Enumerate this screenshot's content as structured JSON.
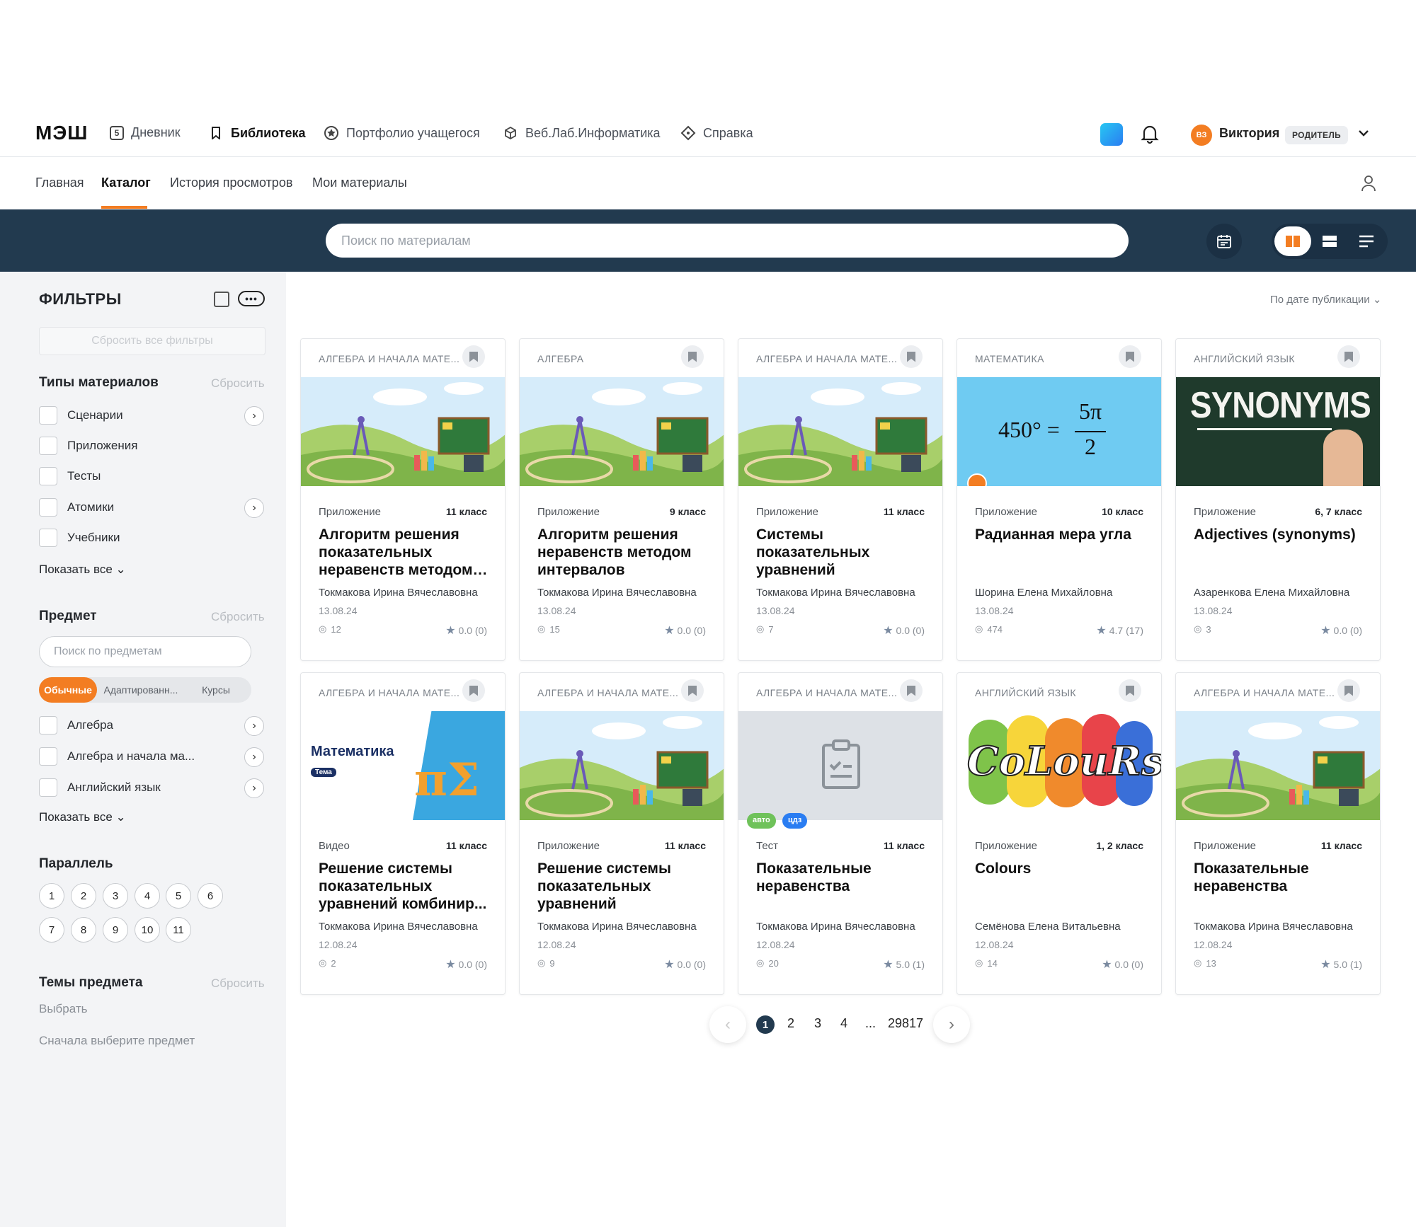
{
  "header": {
    "logo": "МЭШ",
    "nav": [
      {
        "label": "Дневник",
        "icon": "diary-icon"
      },
      {
        "label": "Библиотека",
        "icon": "bookmark-icon"
      },
      {
        "label": "Портфолио учащегося",
        "icon": "star-badge-icon"
      },
      {
        "label": "Веб.Лаб.Информатика",
        "icon": "cube-icon"
      },
      {
        "label": "Справка",
        "icon": "help-diamond-icon"
      }
    ],
    "user": {
      "initials": "ВЗ",
      "name": "Виктория",
      "role": "РОДИТЕЛЬ"
    }
  },
  "subnav": {
    "items": [
      "Главная",
      "Каталог",
      "История просмотров",
      "Мои материалы"
    ],
    "active": "Каталог"
  },
  "search": {
    "placeholder": "Поиск по материалам"
  },
  "filters": {
    "title": "ФИЛЬТРЫ",
    "reset_all": "Сбросить все фильтры",
    "reset": "Сбросить",
    "material_types": {
      "title": "Типы материалов",
      "items": [
        "Сценарии",
        "Приложения",
        "Тесты",
        "Атомики",
        "Учебники"
      ],
      "show_all": "Показать все"
    },
    "subject": {
      "title": "Предмет",
      "search_placeholder": "Поиск по предметам",
      "segments": [
        "Обычные",
        "Адаптированн...",
        "Курсы"
      ],
      "items": [
        "Алгебра",
        "Алгебра и начала ма...",
        "Английский язык"
      ],
      "show_all": "Показать все"
    },
    "parallel": {
      "title": "Параллель",
      "grades": [
        "1",
        "2",
        "3",
        "4",
        "5",
        "6",
        "7",
        "8",
        "9",
        "10",
        "11"
      ]
    },
    "topics": {
      "title": "Темы предмета",
      "choose": "Выбрать",
      "hint": "Сначала выберите предмет"
    }
  },
  "sort": {
    "label": "По дате публикации"
  },
  "cards": [
    {
      "subject": "АЛГЕБРА И НАЧАЛА МАТЕ...",
      "image": "math-landscape",
      "type": "Приложение",
      "grade": "11 класс",
      "title": "Алгоритм решения показательных неравенств методом з...",
      "author": "Токмакова Ирина Вячеславовна",
      "date": "13.08.24",
      "views": "12",
      "rating": "0.0 (0)"
    },
    {
      "subject": "АЛГЕБРА",
      "image": "math-landscape",
      "type": "Приложение",
      "grade": "9 класс",
      "title": "Алгоритм решения неравенств методом интервалов",
      "author": "Токмакова Ирина Вячеславовна",
      "date": "13.08.24",
      "views": "15",
      "rating": "0.0 (0)"
    },
    {
      "subject": "АЛГЕБРА И НАЧАЛА МАТЕ...",
      "image": "math-landscape",
      "type": "Приложение",
      "grade": "11 класс",
      "title": "Системы показательных уравнений",
      "author": "Токмакова Ирина Вячеславовна",
      "date": "13.08.24",
      "views": "7",
      "rating": "0.0 (0)"
    },
    {
      "subject": "МАТЕМАТИКА",
      "image": "radian-formula",
      "type": "Приложение",
      "grade": "10 класс",
      "title": "Радианная мера угла",
      "author": "Шорина Елена Михайловна",
      "date": "13.08.24",
      "views": "474",
      "rating": "4.7 (17)",
      "formula_lhs": "450° =",
      "formula_num": "5π",
      "formula_den": "2"
    },
    {
      "subject": "АНГЛИЙСКИЙ ЯЗЫК",
      "image": "synonyms",
      "type": "Приложение",
      "grade": "6, 7 класс",
      "title": "Adjectives (synonyms)",
      "author": "Азаренкова Елена Михайловна",
      "date": "13.08.24",
      "views": "3",
      "rating": "0.0 (0)",
      "image_text": "SYNONYMS"
    },
    {
      "subject": "АЛГЕБРА И НАЧАЛА МАТЕ...",
      "image": "math-video",
      "type": "Видео",
      "grade": "11 класс",
      "title": "Решение системы показательных уравнений комбинир...",
      "author": "Токмакова Ирина Вячеславовна",
      "date": "12.08.24",
      "views": "2",
      "rating": "0.0 (0)",
      "image_text": "Математика",
      "image_tag": "Тема"
    },
    {
      "subject": "АЛГЕБРА И НАЧАЛА МАТЕ...",
      "image": "math-landscape",
      "type": "Приложение",
      "grade": "11 класс",
      "title": "Решение системы показательных уравнений",
      "author": "Токмакова Ирина Вячеславовна",
      "date": "12.08.24",
      "views": "9",
      "rating": "0.0 (0)"
    },
    {
      "subject": "АЛГЕБРА И НАЧАЛА МАТЕ...",
      "image": "test-clipboard",
      "type": "Тест",
      "grade": "11 класс",
      "title": "Показательные неравенства",
      "author": "Токмакова Ирина Вячеславовна",
      "date": "12.08.24",
      "views": "20",
      "rating": "5.0 (1)",
      "tags": [
        "авто",
        "цдз"
      ]
    },
    {
      "subject": "АНГЛИЙСКИЙ ЯЗЫК",
      "image": "colours",
      "type": "Приложение",
      "grade": "1, 2 класс",
      "title": "Colours",
      "author": "Семёнова Елена Витальевна",
      "date": "12.08.24",
      "views": "14",
      "rating": "0.0 (0)",
      "image_text": "CoLouRs"
    },
    {
      "subject": "АЛГЕБРА И НАЧАЛА МАТЕ...",
      "image": "math-landscape",
      "type": "Приложение",
      "grade": "11 класс",
      "title": "Показательные неравенства",
      "author": "Токмакова Ирина Вячеславовна",
      "date": "12.08.24",
      "views": "13",
      "rating": "5.0 (1)"
    }
  ],
  "pagination": {
    "pages": [
      "1",
      "2",
      "3",
      "4",
      "...",
      "29817"
    ],
    "current": "1"
  },
  "colors": {
    "accent": "#f37d22",
    "navy": "#223a4f",
    "sidebar": "#f3f4f6"
  }
}
